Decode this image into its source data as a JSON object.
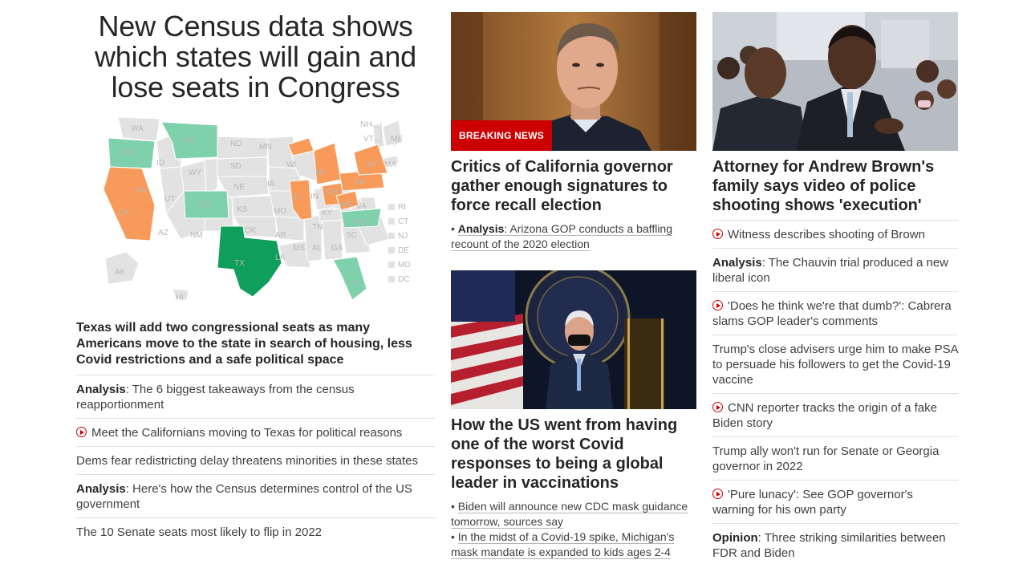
{
  "lead": {
    "headline": "New Census data shows which states will gain and lose seats in Congress",
    "map": {
      "gain_color": "#f79a5a",
      "lose_color": "#7fd1ab",
      "tx_color": "#0f9e5b",
      "neutral_color": "#e2e2e2",
      "labels": [
        "WA",
        "OR",
        "CA",
        "NV",
        "ID",
        "MT",
        "WY",
        "UT",
        "AZ",
        "CO",
        "NM",
        "ND",
        "SD",
        "NE",
        "KS",
        "OK",
        "TX",
        "MN",
        "IA",
        "MO",
        "AR",
        "LA",
        "WI",
        "IL",
        "MS",
        "MI",
        "IN",
        "KY",
        "TN",
        "AL",
        "OH",
        "GA",
        "FL",
        "SC",
        "NC",
        "WV",
        "VA",
        "PA",
        "NY",
        "VT",
        "NH",
        "ME",
        "MA",
        "AK",
        "HI"
      ],
      "legend": [
        "RI",
        "CT",
        "NJ",
        "DE",
        "MD",
        "DC"
      ]
    },
    "subheadline": "Texas will add two congressional seats as many Americans move to the state in search of housing, less Covid restrictions and a safe political space",
    "items": [
      {
        "prefix": "Analysis",
        "text": ": The 6 biggest takeaways from the census reapportionment"
      },
      {
        "video": true,
        "text": "Meet the Californians moving to Texas for political reasons"
      },
      {
        "text": "Dems fear redistricting delay threatens minorities in these states"
      },
      {
        "prefix": "Analysis",
        "text": ": Here's how the Census determines control of the US government"
      },
      {
        "text": "The 10 Senate seats most likely to flip in 2022"
      }
    ]
  },
  "middle": {
    "card1": {
      "badge": "BREAKING NEWS",
      "headline": "Critics of California governor gather enough signatures to force recall election",
      "related_prefix": "Analysis",
      "related_text": ": Arizona GOP conducts a baffling recount of the 2020 election"
    },
    "card2": {
      "headline": "How the US went from having one of the worst Covid responses to being a global leader in vaccinations",
      "related": [
        "Biden will announce new CDC mask guidance tomorrow, sources say",
        "In the midst of a Covid-19 spike, Michigan's mask mandate is expanded to kids ages 2-4"
      ]
    }
  },
  "right": {
    "headline": "Attorney for Andrew Brown's family says video of police shooting shows 'execution'",
    "items": [
      {
        "video": true,
        "text": "Witness describes shooting of Brown"
      },
      {
        "prefix": "Analysis",
        "text": ": The Chauvin trial produced a new liberal icon"
      },
      {
        "video": true,
        "text": "'Does he think we're that dumb?': Cabrera slams GOP leader's comments"
      },
      {
        "text": "Trump's close advisers urge him to make PSA to persuade his followers to get the Covid-19 vaccine"
      },
      {
        "video": true,
        "text": "CNN reporter tracks the origin of a fake Biden story"
      },
      {
        "text": "Trump ally won't run for Senate or Georgia governor in 2022"
      },
      {
        "video": true,
        "text": "'Pure lunacy': See GOP governor's warning for his own party"
      },
      {
        "prefix": "Opinion",
        "text": ": Three striking similarities between FDR and Biden"
      }
    ]
  }
}
